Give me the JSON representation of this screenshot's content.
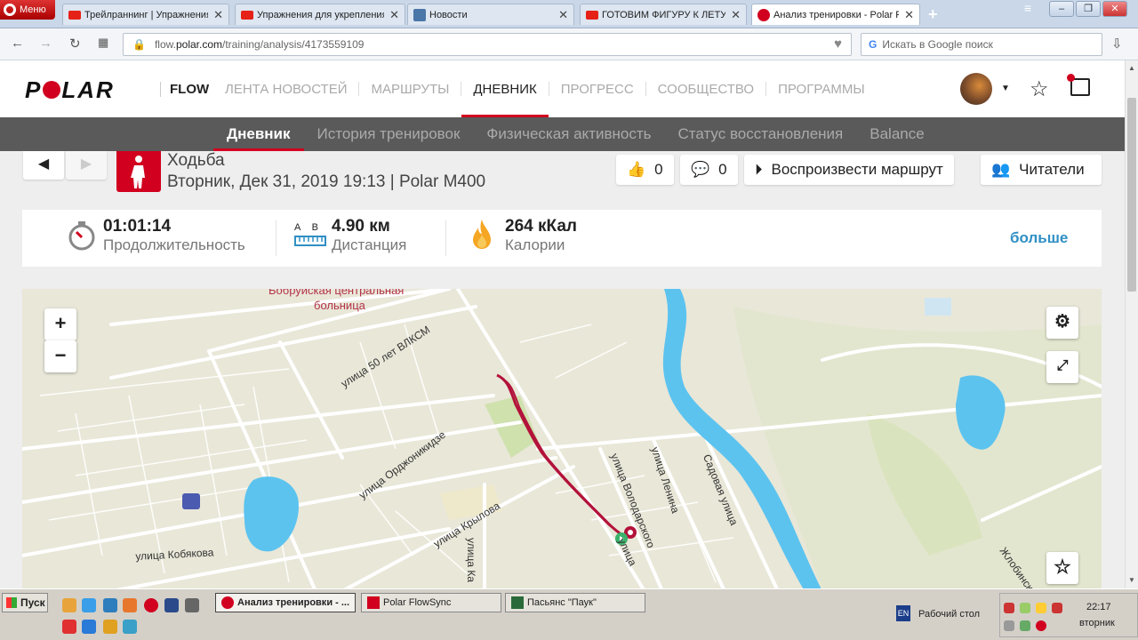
{
  "browser": {
    "menu_label": "Меню",
    "tabs": [
      {
        "title": "Трейлраннинг | Упражнения",
        "favicon": "youtube-icon"
      },
      {
        "title": "Упражнения для укрепления",
        "favicon": "youtube-icon"
      },
      {
        "title": "Новости",
        "favicon": "vk-icon"
      },
      {
        "title": "ГОТОВИМ ФИГУРУ К ЛЕТУ",
        "favicon": "youtube-icon"
      },
      {
        "title": "Анализ тренировки - Polar Flow",
        "favicon": "polar-icon"
      }
    ],
    "url_prefix": "flow.",
    "url_domain": "polar.com",
    "url_path": "/training/analysis/4173559109",
    "search_placeholder": "Искать в Google поиск"
  },
  "header": {
    "logo": "POLAR",
    "product": "FLOW",
    "nav": [
      "ЛЕНТА НОВОСТЕЙ",
      "МАРШРУТЫ",
      "ДНЕВНИК",
      "ПРОГРЕСС",
      "СООБЩЕСТВО",
      "ПРОГРАММЫ"
    ],
    "active_nav": "ДНЕВНИК"
  },
  "subnav": {
    "items": [
      "Дневник",
      "История тренировок",
      "Физическая активность",
      "Статус восстановления",
      "Balance"
    ],
    "active": "Дневник"
  },
  "session": {
    "sport": "Ходьба",
    "date_device": "Вторник, Дек 31, 2019 19:13 | Polar M400",
    "likes": "0",
    "comments": "0",
    "replay_label": "Воспроизвести маршрут",
    "followers_label": "Читатели"
  },
  "summary": {
    "duration": {
      "value": "01:01:14",
      "label": "Продолжительность"
    },
    "distance": {
      "value": "4.90 км",
      "label": "Дистанция",
      "a": "A",
      "b": "B"
    },
    "calories": {
      "value": "264 кКал",
      "label": "Калории"
    },
    "more": "больше"
  },
  "map": {
    "labels": {
      "hospital": "Бобруйская центральная",
      "hospital2": "больница",
      "s1": "улица 50 лет ВЛКСМ",
      "s2": "улица Орджоникидзе",
      "s3": "улица Крылова",
      "s4": "улица Кобякова",
      "s5": "улица Володарского",
      "s6": "улица Ленина",
      "s7": "Садовая улица",
      "s8": "улица Ка",
      "s9": "улица",
      "s10": "Жлобинск"
    }
  },
  "taskbar": {
    "start": "Пуск",
    "tasks": [
      "Анализ тренировки - ...",
      "Polar FlowSync",
      "Пасьянс \"Паук\""
    ],
    "lang": "EN",
    "desktop": "Рабочий стол",
    "time": "22:17",
    "day": "вторник"
  },
  "colors": {
    "accent": "#d1001f",
    "link": "#2f8fc4",
    "water": "#5cc3ef",
    "route": "#b3123a"
  }
}
